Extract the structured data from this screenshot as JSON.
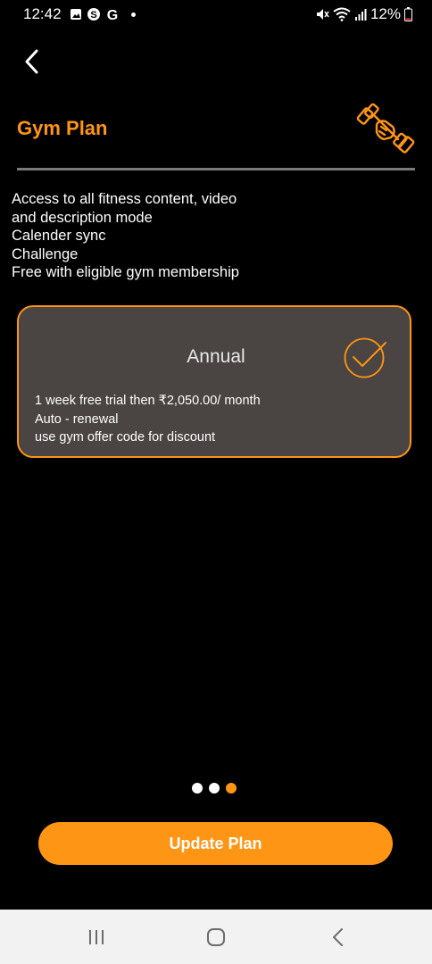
{
  "status_bar": {
    "time": "12:42",
    "battery": "12%"
  },
  "header": {
    "title": "Gym Plan"
  },
  "features": [
    "Access to all fitness content, video",
    "and description mode",
    "Calender sync",
    "Challenge",
    "Free with eligible gym membership"
  ],
  "plan_card": {
    "name": "Annual",
    "selected": true,
    "details": [
      "1 week free trial then ₹2,050.00/ month",
      "Auto - renewal",
      "use gym offer code for discount"
    ]
  },
  "pager": {
    "count": 3,
    "active_index": 2
  },
  "actions": {
    "update_label": "Update Plan"
  },
  "colors": {
    "accent": "#ff9514",
    "card_bg": "#4a4442",
    "background": "#000000",
    "divider": "#7a7a7a"
  },
  "icons": {
    "back": "chevron-left-icon",
    "logo": "dumbbell-fist-icon",
    "check": "check-circle-icon"
  }
}
